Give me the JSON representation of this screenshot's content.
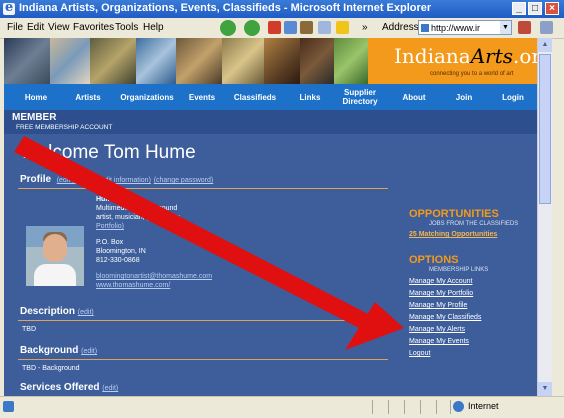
{
  "window": {
    "title": "Indiana Artists, Organizations, Events, Classifieds - Microsoft Internet Explorer",
    "minimize": "_",
    "maximize": "□",
    "close": "×"
  },
  "menubar": {
    "items": [
      "File",
      "Edit",
      "View",
      "Favorites",
      "Tools",
      "Help"
    ],
    "chevron": "»",
    "address_label": "Address",
    "address_value": "http://www.ir",
    "go": "▼"
  },
  "brand": {
    "logo_text": "Indiana",
    "logo_italic": "Arts",
    "logo_suffix": ".org",
    "tagline": "connecting you to a world of art"
  },
  "nav": [
    "Home",
    "Artists",
    "Organizations",
    "Events",
    "Classifieds",
    "Links",
    "Supplier Directory",
    "About",
    "Join",
    "Login"
  ],
  "member": {
    "title": "MEMBER",
    "subtitle": "FREE MEMBERSHIP ACCOUNT"
  },
  "welcome": "Welcome Tom Hume",
  "profile": {
    "heading": "Profile",
    "links": [
      "(edit picture)",
      "(edit information)",
      "(change password)"
    ],
    "name": "Hume, Tom",
    "desc_line1": "Multimedia visual & sound",
    "desc_line2": "artist, musician, poet",
    "view_link": "(View",
    "view_link2": "Portfolio)",
    "po_box": "P.O. Box",
    "city": "Bloomington, IN",
    "phone": "812-330-0868",
    "email": "bloomingtonartist@thomashume.com",
    "website": "www.thomashume.com/"
  },
  "description": {
    "heading": "Description",
    "edit": "(edit)",
    "text": "TBD"
  },
  "background": {
    "heading": "Background",
    "edit": "(edit)",
    "text": "TBD - Background"
  },
  "services": {
    "heading": "Services Offered",
    "edit": "(edit)"
  },
  "opportunities": {
    "heading": "OPPORTUNITIES",
    "subheading": "JOBS FROM THE CLASSIFIEDS",
    "link": "25 Matching Opportunities"
  },
  "options": {
    "heading": "OPTIONS",
    "subheading": "MEMBERSHIP LINKS",
    "links": [
      "Manage My Account",
      "Manage My Portfolio",
      "Manage My Profile",
      "Manage My Classifieds",
      "Manage My Alerts",
      "Manage My Events",
      "Logout"
    ]
  },
  "statusbar": {
    "zone": "Internet"
  },
  "colors": {
    "page_bg": "#3d5e9a",
    "nav_bg": "#1d71c9",
    "brand_orange": "#f39a1c",
    "arrow_red": "#e01010"
  }
}
